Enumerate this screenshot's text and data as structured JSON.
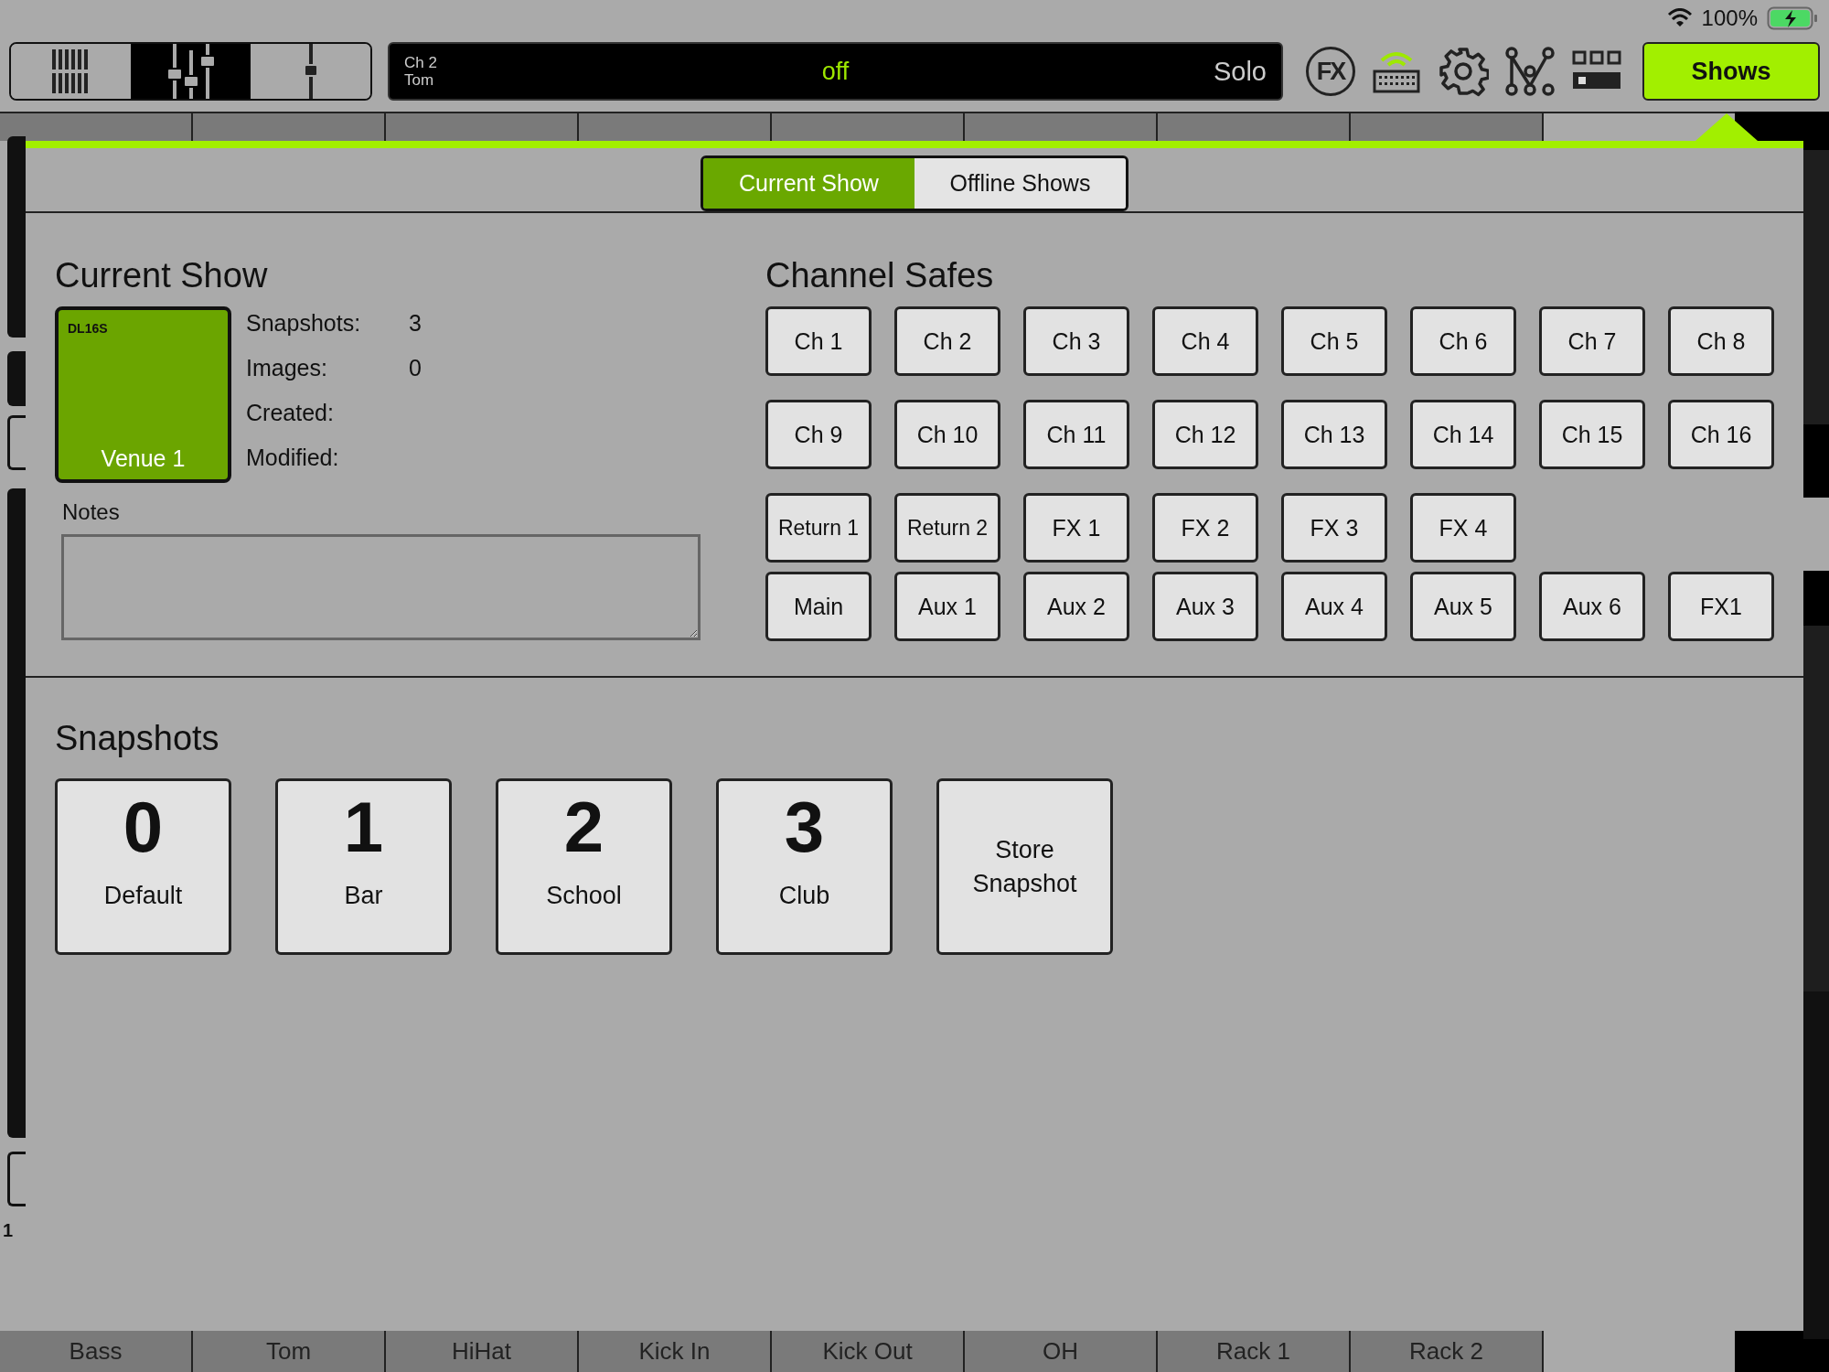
{
  "status_bar": {
    "battery": "100%"
  },
  "view_tabs": [
    {
      "kind": "grid",
      "selected": false
    },
    {
      "kind": "faders",
      "selected": true
    },
    {
      "kind": "single",
      "selected": false
    }
  ],
  "channel_display": {
    "channel": "Ch 2",
    "name": "Tom",
    "state": "off",
    "solo": "Solo"
  },
  "toolbar": {
    "fx_label": "FX"
  },
  "shows_button": {
    "label": "Shows",
    "selected": true
  },
  "mode_tabs": [
    {
      "label": "Current Show",
      "selected": true
    },
    {
      "label": "Offline Shows",
      "selected": false
    }
  ],
  "current_show": {
    "title": "Current Show",
    "show": {
      "model": "DL16S",
      "name": "Venue 1"
    },
    "info": [
      {
        "label": "Snapshots:",
        "value": "3"
      },
      {
        "label": "Images:",
        "value": "0"
      },
      {
        "label": "Created:"
      },
      {
        "label": "Modified:"
      }
    ],
    "notes_label": "Notes"
  },
  "channel_safes": {
    "title": "Channel Safes",
    "rows": [
      [
        "Ch 1",
        "Ch 2",
        "Ch 3",
        "Ch 4",
        "Ch 5",
        "Ch 6",
        "Ch 7",
        "Ch 8"
      ],
      [
        "Ch 9",
        "Ch 10",
        "Ch 11",
        "Ch 12",
        "Ch 13",
        "Ch 14",
        "Ch 15",
        "Ch 16"
      ],
      [
        "Return 1",
        "Return 2",
        "FX 1",
        "FX 2",
        "FX 3",
        "FX 4"
      ],
      [
        "Main",
        "Aux 1",
        "Aux 2",
        "Aux 3",
        "Aux 4",
        "Aux 5",
        "Aux 6",
        "FX1"
      ]
    ]
  },
  "snapshots": {
    "title": "Snapshots",
    "items": [
      {
        "number": "0",
        "name": "Default"
      },
      {
        "number": "1",
        "name": "Bar"
      },
      {
        "number": "2",
        "name": "School"
      },
      {
        "number": "3",
        "name": "Club"
      }
    ],
    "store_button": "Store Snapshot"
  },
  "mixer": {
    "strip_number": "1",
    "channel_names": [
      "Bass",
      "Tom",
      "HiHat",
      "Kick In",
      "Kick Out",
      "OH",
      "Rack 1",
      "Rack 2"
    ]
  }
}
